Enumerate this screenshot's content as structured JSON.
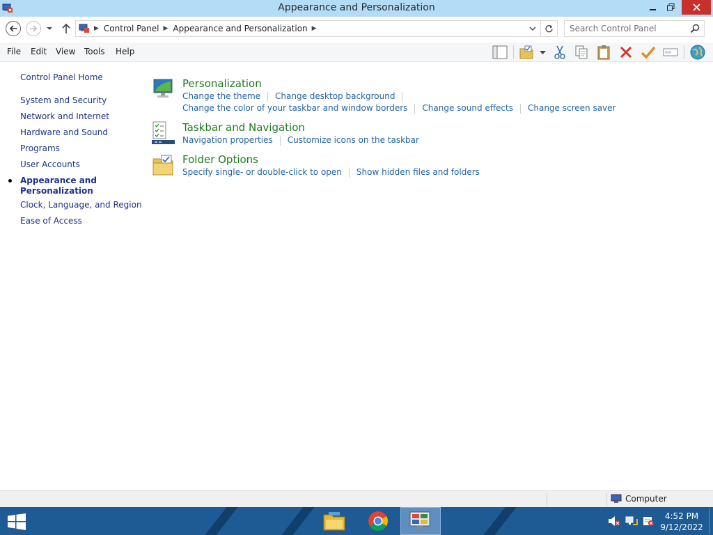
{
  "window": {
    "title": "Appearance and Personalization"
  },
  "address": {
    "crumbs": [
      "Control Panel",
      "Appearance and Personalization"
    ],
    "search_placeholder": "Search Control Panel"
  },
  "menu": [
    "File",
    "Edit",
    "View",
    "Tools",
    "Help"
  ],
  "sidebar": {
    "home": "Control Panel Home",
    "items": [
      "System and Security",
      "Network and Internet",
      "Hardware and Sound",
      "Programs",
      "User Accounts",
      "Appearance and Personalization",
      "Clock, Language, and Region",
      "Ease of Access"
    ],
    "current_index": 5
  },
  "categories": [
    {
      "title": "Personalization",
      "links_row1": [
        "Change the theme",
        "Change desktop background"
      ],
      "links_row2": [
        "Change the color of your taskbar and window borders",
        "Change sound effects",
        "Change screen saver"
      ]
    },
    {
      "title": "Taskbar and Navigation",
      "links_row1": [
        "Navigation properties",
        "Customize icons on the taskbar"
      ]
    },
    {
      "title": "Folder Options",
      "links_row1": [
        "Specify single- or double-click to open",
        "Show hidden files and folders"
      ]
    }
  ],
  "status": {
    "computer": "Computer"
  },
  "clock": {
    "time": "4:52 PM",
    "date": "9/12/2022"
  },
  "colors": {
    "title_bar": "#b3dcf7",
    "close": "#c7312c",
    "category_title": "#1e7b1e",
    "task_link": "#1e64a8",
    "side_link": "#1e3287",
    "taskbar": "#1e5a94"
  }
}
